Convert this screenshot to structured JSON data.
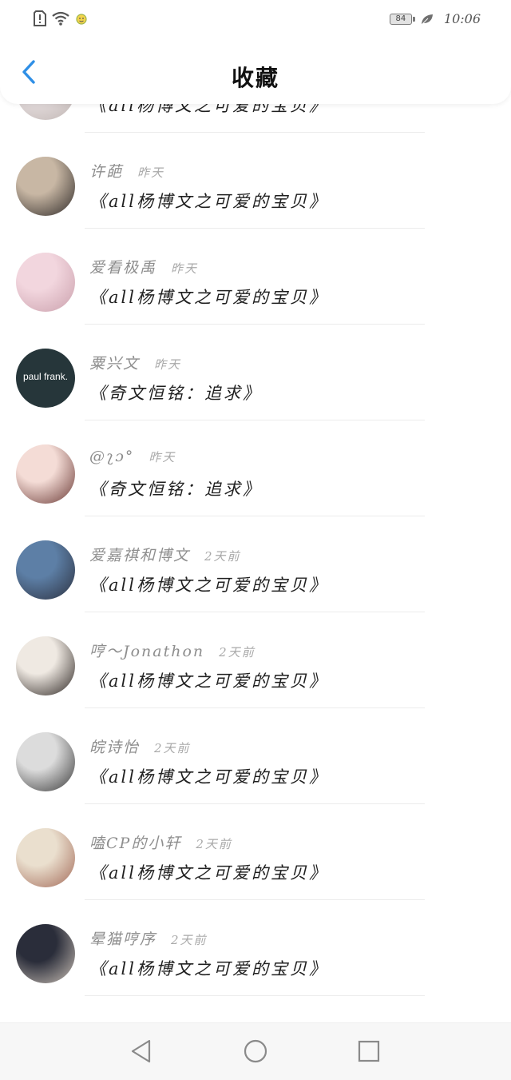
{
  "status_bar": {
    "alert_icon": "alert-icon",
    "wifi_icon": "wifi-icon",
    "notification_icon": "emoji-notification-icon",
    "battery_level": "84",
    "leaf_icon": "leaf-icon",
    "time": "10:06"
  },
  "header": {
    "back_icon": "chevron-left-icon",
    "title": "收藏"
  },
  "favorites": [
    {
      "user": "",
      "time": "",
      "title": "《all杨博文之可爱的宝贝》",
      "avatar_colors": [
        "#e7dfe0",
        "#bfb5b2"
      ]
    },
    {
      "user": "许葩",
      "time": "昨天",
      "title": "《all杨博文之可爱的宝贝》",
      "avatar_colors": [
        "#c8b7a4",
        "#2f2a28"
      ]
    },
    {
      "user": "爱看极禹",
      "time": "昨天",
      "title": "《all杨博文之可爱的宝贝》",
      "avatar_colors": [
        "#f2d6de",
        "#caa0ac"
      ]
    },
    {
      "user": "粟兴文",
      "time": "昨天",
      "title": "《奇文恒铭：追求》",
      "avatar_colors": [
        "#26363a",
        "#26363a"
      ],
      "avatar_text": "paul frank."
    },
    {
      "user": "@ʅɔ°",
      "time": "昨天",
      "title": "《奇文恒铭：追求》",
      "avatar_colors": [
        "#f4dcd6",
        "#6b3a36"
      ]
    },
    {
      "user": "爱嘉祺和博文",
      "time": "2天前",
      "title": "《all杨博文之可爱的宝贝》",
      "avatar_colors": [
        "#5d7fa6",
        "#2c3140"
      ]
    },
    {
      "user": "哼～Jonathon",
      "time": "2天前",
      "title": "《all杨博文之可爱的宝贝》",
      "avatar_colors": [
        "#efe9e2",
        "#2d2623"
      ]
    },
    {
      "user": "皖诗怡",
      "time": "2天前",
      "title": "《all杨博文之可爱的宝贝》",
      "avatar_colors": [
        "#dcdcdc",
        "#3a3a3a"
      ]
    },
    {
      "user": "嗑CP的小轩",
      "time": "2天前",
      "title": "《all杨博文之可爱的宝贝》",
      "avatar_colors": [
        "#eadfce",
        "#a36a58"
      ]
    },
    {
      "user": "晕猫哼序",
      "time": "2天前",
      "title": "《all杨博文之可爱的宝贝》",
      "avatar_colors": [
        "#2a2d3a",
        "#c9bfb5"
      ]
    }
  ],
  "nav": {
    "back_icon": "triangle-back-icon",
    "home_icon": "circle-home-icon",
    "recents_icon": "square-recents-icon"
  },
  "colors": {
    "accent": "#2f8fe6",
    "title_text": "#111111",
    "meta_text": "#8e8e8e"
  }
}
